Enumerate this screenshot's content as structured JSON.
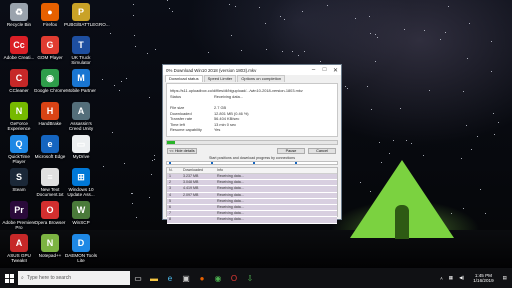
{
  "desktop_icons": [
    {
      "label": "Recycle Bin",
      "icon": "recycle-bin-icon",
      "color": "#9aa3ad",
      "glyph": "♻"
    },
    {
      "label": "Firefox",
      "icon": "firefox-icon",
      "color": "#e66000",
      "glyph": "●"
    },
    {
      "label": "PUBG/BATTLEGRO...",
      "icon": "pubg-icon",
      "color": "#c9a227",
      "glyph": "P"
    },
    {
      "label": "Adobe Creati...",
      "icon": "adobe-cc-icon",
      "color": "#da1f26",
      "glyph": "Cc"
    },
    {
      "label": "GOM Player",
      "icon": "gom-player-icon",
      "color": "#e03c31",
      "glyph": "G"
    },
    {
      "label": "UK Truck Simulator",
      "icon": "uk-truck-simulator-icon",
      "color": "#1e4fa0",
      "glyph": "T"
    },
    {
      "label": "CCleaner",
      "icon": "ccleaner-icon",
      "color": "#c62828",
      "glyph": "C"
    },
    {
      "label": "Google Chrome",
      "icon": "chrome-icon",
      "color": "#2e9d4a",
      "glyph": "◉"
    },
    {
      "label": "Mobile Partner",
      "icon": "mobile-partner-icon",
      "color": "#1976d2",
      "glyph": "M"
    },
    {
      "label": "GeForce Experience",
      "icon": "geforce-icon",
      "color": "#76b900",
      "glyph": "N"
    },
    {
      "label": "HandBrake",
      "icon": "handbrake-icon",
      "color": "#d84315",
      "glyph": "H"
    },
    {
      "label": "Assassin's Creed Unity",
      "icon": "ac-unity-icon",
      "color": "#546e7a",
      "glyph": "A"
    },
    {
      "label": "QuickTime Player",
      "icon": "quicktime-icon",
      "color": "#1e88e5",
      "glyph": "Q"
    },
    {
      "label": "Microsoft Edge",
      "icon": "edge-icon",
      "color": "#1565c0",
      "glyph": "e"
    },
    {
      "label": "MyDrive",
      "icon": "mydrive-icon",
      "color": "#eceff1",
      "glyph": "▭"
    },
    {
      "label": "Steam",
      "icon": "steam-icon",
      "color": "#1b2838",
      "glyph": "S"
    },
    {
      "label": "New Text Document.txt",
      "icon": "text-document-icon",
      "color": "#e0e0e0",
      "glyph": "≡"
    },
    {
      "label": "Windows 10 Update Ass...",
      "icon": "windows-update-icon",
      "color": "#0078d7",
      "glyph": "⊞"
    },
    {
      "label": "Adobe Premiere Pro",
      "icon": "premiere-icon",
      "color": "#2a0a3a",
      "glyph": "Pr"
    },
    {
      "label": "Opera Browser",
      "icon": "opera-icon",
      "color": "#d32f2f",
      "glyph": "O"
    },
    {
      "label": "WinSCP",
      "icon": "winscp-icon",
      "color": "#4a7a3a",
      "glyph": "W"
    },
    {
      "label": "ASUS GPU TweakII",
      "icon": "asus-gpu-tweak-icon",
      "color": "#c62828",
      "glyph": "A"
    },
    {
      "label": "Notepad++",
      "icon": "notepadpp-icon",
      "color": "#7cb342",
      "glyph": "N"
    },
    {
      "label": "DAEMON Tools Lite",
      "icon": "daemon-tools-icon",
      "color": "#1e88e5",
      "glyph": "D"
    }
  ],
  "download_window": {
    "title": "0% Download Win10 2018 (version 1803).mkv",
    "tabs": [
      "Download status",
      "Speed Limiter",
      "Options on completion"
    ],
    "url": "https://s11.uploadbox.co/d/files/dl/bigupload/.../win10-2018-version-1803.mkv",
    "status_label": "Status",
    "status_value": "Receiving data...",
    "fields": [
      {
        "label": "File size",
        "value": "2.7 GB"
      },
      {
        "label": "Downloaded",
        "value": "12.801 MB (0.46 %)"
      },
      {
        "label": "Transfer rate",
        "value": "56.404 KB/sec"
      },
      {
        "label": "Time left",
        "value": "13 min 0 sec"
      },
      {
        "label": "Resume capability",
        "value": "Yes"
      }
    ],
    "progress_fraction": 0.046,
    "hide_details_label": "<< Hide details",
    "pause_label": "Pause",
    "cancel_label": "Cancel",
    "caption": "Start positions and download progress by connections",
    "table_headers": [
      "N.",
      "Downloaded",
      "Info"
    ],
    "rows": [
      {
        "n": "1",
        "downloaded": "3.237 MB",
        "info": "Receiving data..."
      },
      {
        "n": "2",
        "downloaded": "3.048 MB",
        "info": "Receiving data..."
      },
      {
        "n": "3",
        "downloaded": "4.419 MB",
        "info": "Receiving data..."
      },
      {
        "n": "4",
        "downloaded": "2.097 MB",
        "info": "Receiving data..."
      },
      {
        "n": "5",
        "downloaded": "",
        "info": "Receiving data..."
      },
      {
        "n": "6",
        "downloaded": "",
        "info": "Receiving data..."
      },
      {
        "n": "7",
        "downloaded": "",
        "info": "Receiving data..."
      },
      {
        "n": "8",
        "downloaded": "",
        "info": "Receiving data..."
      }
    ]
  },
  "taskbar": {
    "search_placeholder": "Type here to search",
    "time": "1:45 PM",
    "date": "1/16/2019"
  }
}
